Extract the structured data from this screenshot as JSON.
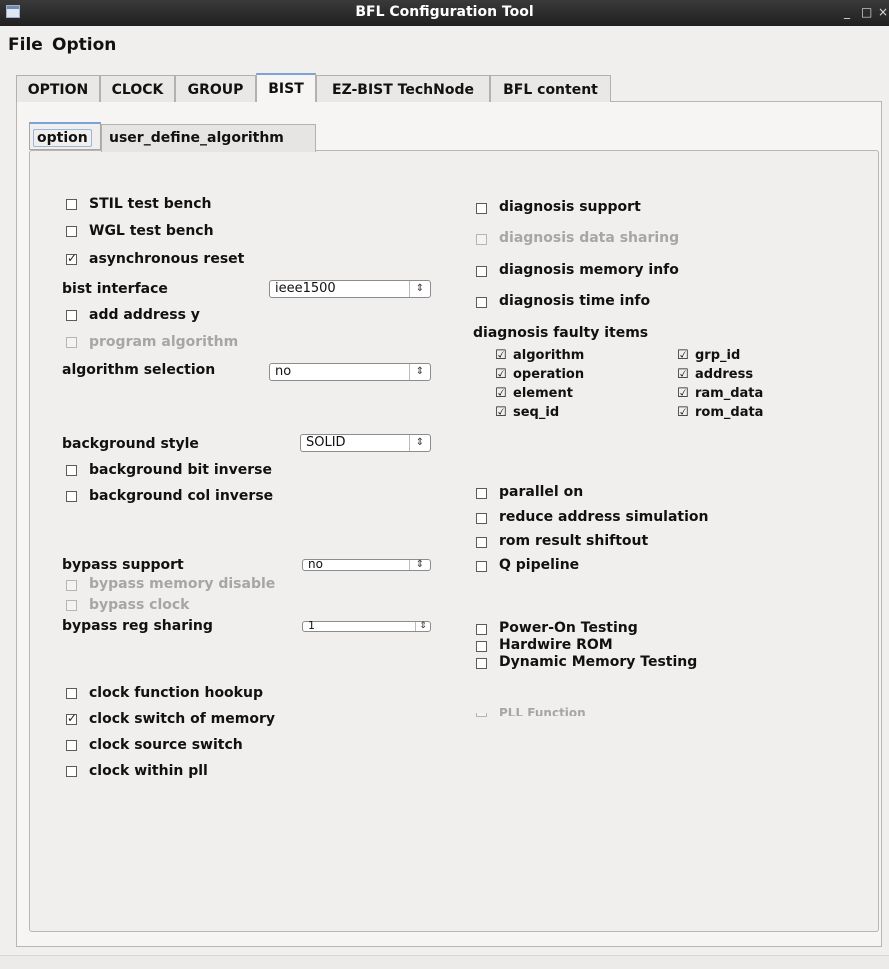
{
  "window": {
    "title": "BFL Configuration Tool",
    "controls": [
      "_",
      "□",
      "×"
    ]
  },
  "menubar": {
    "file": "File",
    "option": "Option"
  },
  "tabs": [
    {
      "label": "OPTION"
    },
    {
      "label": "CLOCK"
    },
    {
      "label": "GROUP"
    },
    {
      "label": "BIST",
      "active": true
    },
    {
      "label": "EZ-BIST TechNode"
    },
    {
      "label": "BFL content"
    }
  ],
  "subtabs": [
    {
      "label": "option",
      "active": true
    },
    {
      "label": "user_define_algorithm"
    }
  ],
  "left": {
    "stil_test_bench": {
      "label": "STIL test bench",
      "checked": false
    },
    "wgl_test_bench": {
      "label": "WGL test bench",
      "checked": false
    },
    "async_reset": {
      "label": "asynchronous reset",
      "checked": true
    },
    "bist_interface": {
      "label": "bist interface",
      "value": "ieee1500"
    },
    "add_address_y": {
      "label": "add address y",
      "checked": false
    },
    "program_algorithm": {
      "label": "program algorithm",
      "checked": false,
      "disabled": true
    },
    "algorithm_selection": {
      "label": "algorithm selection",
      "value": "no"
    },
    "background_style": {
      "label": "background style",
      "value": "SOLID"
    },
    "bg_bit_inverse": {
      "label": "background bit inverse",
      "checked": false
    },
    "bg_col_inverse": {
      "label": "background col inverse",
      "checked": false
    },
    "bypass_support": {
      "label": "bypass support",
      "value": "no"
    },
    "bypass_memory_disable": {
      "label": "bypass memory disable",
      "checked": false,
      "disabled": true
    },
    "bypass_clock": {
      "label": "bypass clock",
      "checked": false,
      "disabled": true
    },
    "bypass_reg_sharing": {
      "label": "bypass reg sharing",
      "value": "1"
    },
    "clock_function_hookup": {
      "label": "clock function hookup",
      "checked": false
    },
    "clock_switch_memory": {
      "label": "clock switch of memory",
      "checked": true
    },
    "clock_source_switch": {
      "label": "clock source switch",
      "checked": false
    },
    "clock_within_pll": {
      "label": "clock within pll",
      "checked": false
    }
  },
  "right": {
    "diagnosis_support": {
      "label": "diagnosis support",
      "checked": false
    },
    "diagnosis_data_sharing": {
      "label": "diagnosis data sharing",
      "checked": false,
      "disabled": true
    },
    "diagnosis_memory_info": {
      "label": "diagnosis memory info",
      "checked": false
    },
    "diagnosis_time_info": {
      "label": "diagnosis time info",
      "checked": false
    },
    "faulty_items": {
      "heading": "diagnosis faulty items",
      "items": [
        {
          "label": "algorithm",
          "checked": true
        },
        {
          "label": "grp_id",
          "checked": true
        },
        {
          "label": "operation",
          "checked": true
        },
        {
          "label": "address",
          "checked": true
        },
        {
          "label": "element",
          "checked": true
        },
        {
          "label": "ram_data",
          "checked": true
        },
        {
          "label": "seq_id",
          "checked": true
        },
        {
          "label": "rom_data",
          "checked": true
        }
      ]
    },
    "parallel_on": {
      "label": "parallel on",
      "checked": false
    },
    "reduce_address_simulation": {
      "label": "reduce address simulation",
      "checked": false
    },
    "rom_result_shiftout": {
      "label": "rom result shiftout",
      "checked": false
    },
    "q_pipeline": {
      "label": "Q pipeline",
      "checked": false
    },
    "power_on_testing": {
      "label": "Power-On Testing",
      "checked": false
    },
    "hardwire_rom": {
      "label": "Hardwire ROM",
      "checked": false
    },
    "dynamic_memory_testing": {
      "label": "Dynamic Memory Testing",
      "checked": false
    },
    "pll_function": {
      "label": "PLL Function",
      "checked": false,
      "disabled": true
    }
  }
}
